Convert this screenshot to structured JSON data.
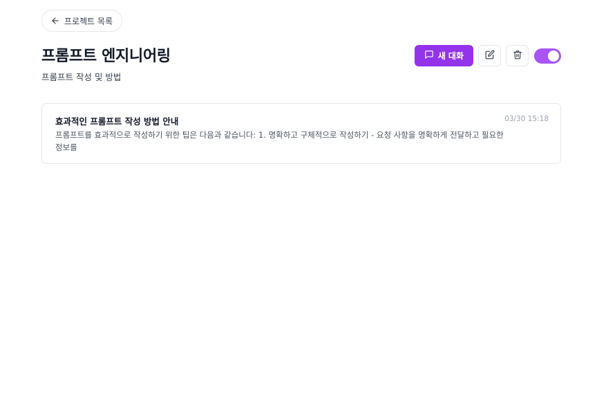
{
  "header": {
    "back_label": "프로젝트 목록",
    "title": "프롬프트 엔지니어링",
    "subtitle": "프롬프트 작성 및 방법"
  },
  "actions": {
    "new_chat_label": "새 대화",
    "toggle_on": true
  },
  "conversations": [
    {
      "title": "효과적인 프롬프트 작성 방법 안내",
      "date": "03/30 15:18",
      "preview": "프롬프트를 효과적으로 작성하기 위한 팁은 다음과 같습니다: 1. 명확하고 구체적으로 작성하기 - 요청 사항을 명확하게 전달하고 필요한 정보를"
    }
  ],
  "colors": {
    "accent": "#9333ea",
    "toggle": "#a855f7",
    "border": "#e5e7eb"
  }
}
